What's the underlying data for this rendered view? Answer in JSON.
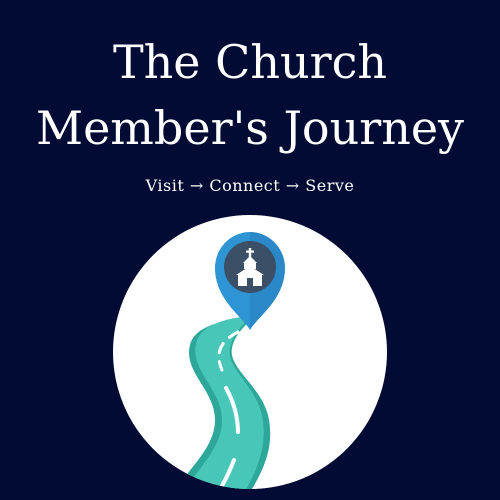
{
  "title": {
    "line1": "The Church",
    "line2": "Member's Journey"
  },
  "subtitle": "Visit → Connect → Serve",
  "colors": {
    "background": "#020b34",
    "circle": "#ffffff",
    "road": "#48c6b8",
    "road_shadow": "#2ea79b",
    "pin_outer": "#2f94d4",
    "pin_inner": "#3b4f66",
    "church": "#ffffff"
  },
  "icons": {
    "pin": "location-pin-icon",
    "church": "church-icon",
    "road": "winding-road-icon"
  }
}
